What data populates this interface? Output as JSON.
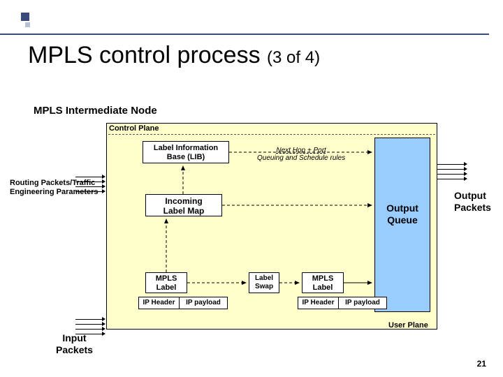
{
  "title_main": "MPLS control process ",
  "title_sub": "(3 of 4)",
  "section_title": "MPLS Intermediate Node",
  "control_plane": "Control Plane",
  "user_plane": "User Plane",
  "lib": {
    "line1": "Label Information",
    "line2": "Base (LIB)"
  },
  "ilm": {
    "line1": "Incoming",
    "line2": "Label Map"
  },
  "nexthop": {
    "line1": "Next Hop + Port",
    "line2": "Queuing and Schedule rules"
  },
  "output_queue": {
    "line1": "Output",
    "line2": "Queue"
  },
  "mpls_label": {
    "line1": "MPLS",
    "line2": "Label"
  },
  "label_swap": {
    "line1": "Label",
    "line2": "Swap"
  },
  "ip": {
    "header": "IP Header",
    "payload": "IP payload"
  },
  "routing": {
    "line1": "Routing Packets/Traffic",
    "line2": "Engineering Parameters"
  },
  "input_packets": {
    "line1": "Input",
    "line2": "Packets"
  },
  "output_packets": {
    "line1": "Output",
    "line2": "Packets"
  },
  "page_num": "21"
}
